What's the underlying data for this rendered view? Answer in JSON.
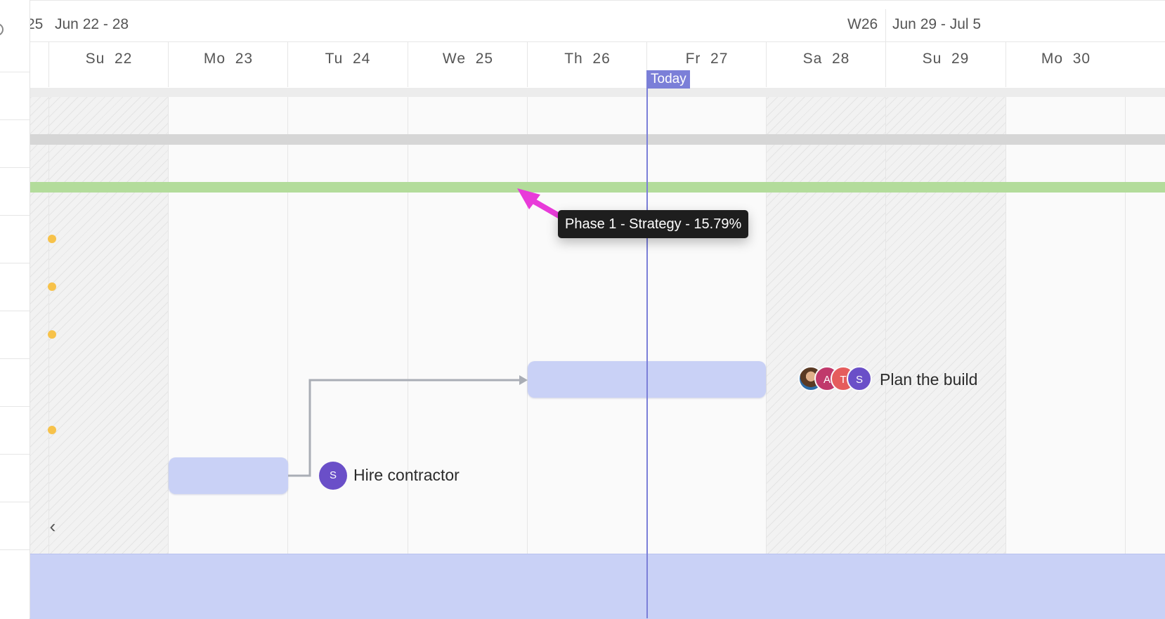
{
  "header": {
    "weeks": [
      {
        "label": "25",
        "name": "week-label-w25"
      },
      {
        "label": "Jun 22 - 28",
        "name": "week-range-jun22"
      },
      {
        "label": "W26",
        "name": "week-label-w26"
      },
      {
        "label": "Jun 29 - Jul 5",
        "name": "week-range-jun29"
      }
    ],
    "days": [
      {
        "label": "Su  22",
        "weekend": true
      },
      {
        "label": "Mo  23",
        "weekend": false
      },
      {
        "label": "Tu  24",
        "weekend": false
      },
      {
        "label": "We  25",
        "weekend": false
      },
      {
        "label": "Th  26",
        "weekend": false
      },
      {
        "label": "Fr  27",
        "weekend": false
      },
      {
        "label": "Sa  28",
        "weekend": true
      },
      {
        "label": "Su  29",
        "weekend": true
      },
      {
        "label": "Mo  30",
        "weekend": false
      }
    ]
  },
  "today": {
    "label": "Today",
    "color": "#7b7fd8"
  },
  "tooltip": {
    "text": "Phase 1 - Strategy - 15.79%"
  },
  "tasks": {
    "plan_build": {
      "label": "Plan the build",
      "assignees": [
        {
          "initial": "",
          "color": "#c48a5a",
          "kind": "photo"
        },
        {
          "initial": "A",
          "color": "#c0396b"
        },
        {
          "initial": "T",
          "color": "#e55c5c"
        },
        {
          "initial": "S",
          "color": "#6a4fc8"
        }
      ]
    },
    "hire_contractor": {
      "label": "Hire contractor",
      "assignees": [
        {
          "initial": "S",
          "color": "#6a4fc8"
        }
      ]
    }
  },
  "colors": {
    "phase_light": "#ececec",
    "phase_mid": "#d6d6d6",
    "phase_green": "#b3dc9b",
    "task_bar": "#c9d1f6",
    "milestone": "#f7c24a",
    "pointer_arrow": "#e83bd9"
  },
  "nav": {
    "scroll_left_icon": "chevron-left-icon"
  }
}
